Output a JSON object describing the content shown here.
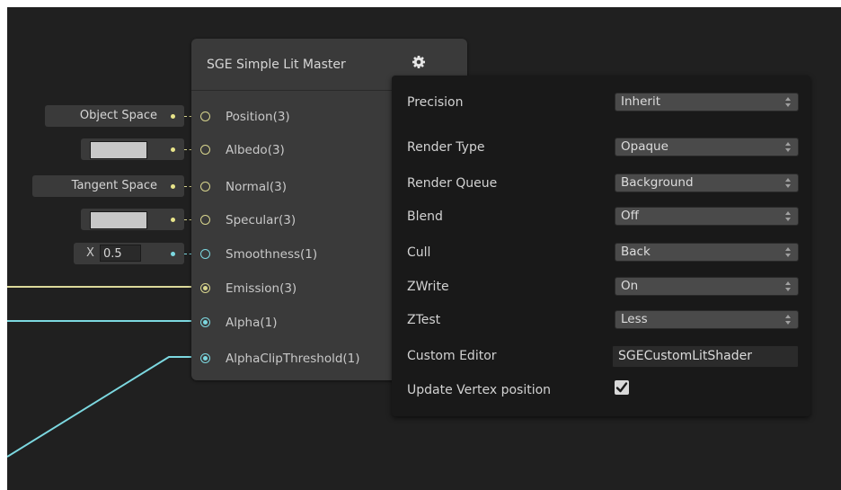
{
  "node": {
    "title": "SGE Simple Lit Master",
    "settings_icon": "gear-icon",
    "ports": [
      {
        "label": "Position(3)",
        "color": "#d8d58e",
        "connected": false
      },
      {
        "label": "Albedo(3)",
        "color": "#d8d58e",
        "connected": false
      },
      {
        "label": "Normal(3)",
        "color": "#d8d58e",
        "connected": false
      },
      {
        "label": "Specular(3)",
        "color": "#d8d58e",
        "connected": false
      },
      {
        "label": "Smoothness(1)",
        "color": "#7cd8e0",
        "connected": false
      },
      {
        "label": "Emission(3)",
        "color": "#d8d58e",
        "connected": true
      },
      {
        "label": "Alpha(1)",
        "color": "#7cd8e0",
        "connected": true
      },
      {
        "label": "AlphaClipThreshold(1)",
        "color": "#7cd8e0",
        "connected": true
      }
    ]
  },
  "inputs": {
    "position_space": "Object Space",
    "normal_space": "Tangent Space",
    "albedo_color": "#c8c8c8",
    "specular_color": "#c8c8c8",
    "smoothness_axis": "X",
    "smoothness_value": "0.5"
  },
  "settings": {
    "precision": {
      "label": "Precision",
      "value": "Inherit"
    },
    "render_type": {
      "label": "Render Type",
      "value": "Opaque"
    },
    "render_queue": {
      "label": "Render Queue",
      "value": "Background"
    },
    "blend": {
      "label": "Blend",
      "value": "Off"
    },
    "cull": {
      "label": "Cull",
      "value": "Back"
    },
    "zwrite": {
      "label": "ZWrite",
      "value": "On"
    },
    "ztest": {
      "label": "ZTest",
      "value": "Less"
    },
    "custom_editor": {
      "label": "Custom Editor",
      "value": "SGECustomLitShader"
    },
    "update_vertex_position": {
      "label": "Update Vertex position",
      "checked": true
    }
  },
  "colors": {
    "vector3": "#d8d58e",
    "vector1": "#7cd8e0",
    "canvas": "#202020",
    "node": "#3a3a3a",
    "panel": "#191919"
  }
}
